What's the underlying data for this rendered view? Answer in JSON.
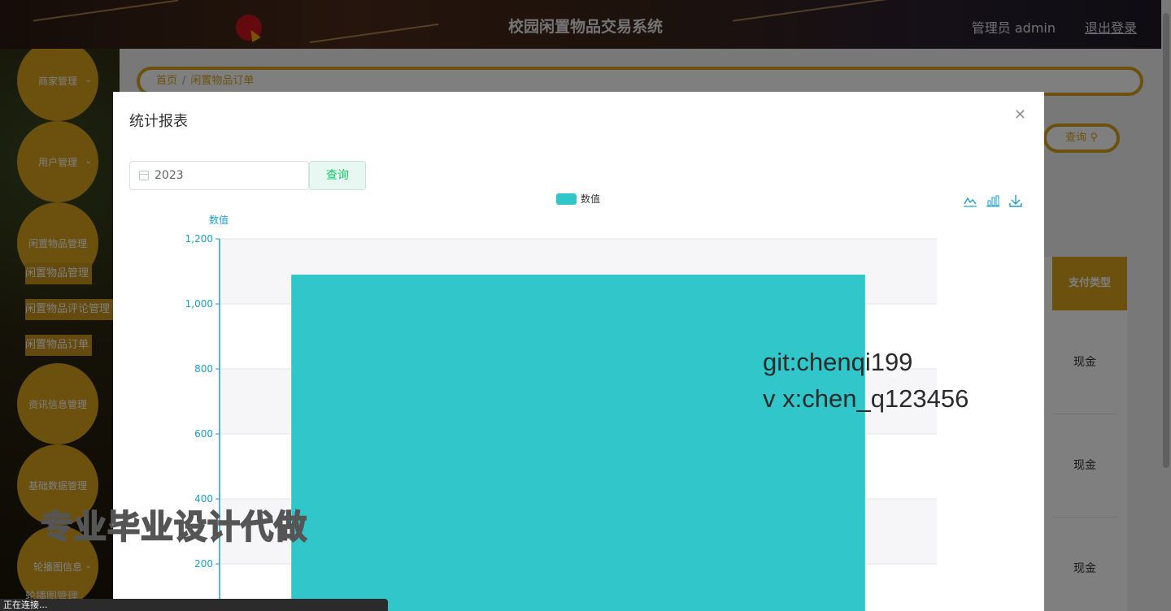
{
  "header": {
    "site_title": "校园闲置物品交易系统",
    "admin_label": "管理员 admin",
    "logout_label": "退出登录"
  },
  "sidebar": {
    "menus": [
      {
        "label": "商家管理"
      },
      {
        "label": "用户管理"
      },
      {
        "label": "闲置物品管理"
      },
      {
        "label": "资讯信息管理"
      },
      {
        "label": "基础数据管理"
      },
      {
        "label": "轮播图信息"
      }
    ],
    "sub_items": [
      {
        "label": "闲置物品管理"
      },
      {
        "label": "闲置物品评论管理"
      },
      {
        "label": "闲置物品订单"
      }
    ],
    "bottom_item": "轮播图管理"
  },
  "breadcrumb": {
    "home": "首页",
    "separator": "/",
    "current": "闲置物品订单"
  },
  "background_page": {
    "query_label": "查询",
    "column_header": "支付类型",
    "rows": [
      "现金",
      "现金",
      "现金"
    ]
  },
  "dialog": {
    "title": "统计报表",
    "close_icon": "close-icon",
    "year_value": "2023",
    "query_button": "查询",
    "toolbox_icons": [
      "line-chart-icon",
      "bar-chart-icon",
      "download-icon"
    ]
  },
  "chart_data": {
    "type": "bar",
    "categories": [
      ""
    ],
    "series": [
      {
        "name": "数值",
        "values": [
          1090
        ],
        "color": "#30c6ca"
      }
    ],
    "ylabel": "数值",
    "ylim": [
      0,
      1200
    ],
    "yticks": [
      200,
      400,
      600,
      800,
      1000,
      1200
    ],
    "y_tick_labels": [
      "200",
      "400",
      "600",
      "800",
      "1,000",
      "1,200"
    ],
    "grid": true,
    "legend_position": "top-center"
  },
  "watermarks": {
    "git": "git:chenqi199",
    "wechat": "v x:chen_q123456",
    "promo": "专业毕业设计代做"
  },
  "status_bar": {
    "text": "正在连接..."
  },
  "colors": {
    "accent": "#d9a21c",
    "bar": "#30c6ca",
    "axis": "#1e9ec9",
    "success": "#13ce66"
  }
}
